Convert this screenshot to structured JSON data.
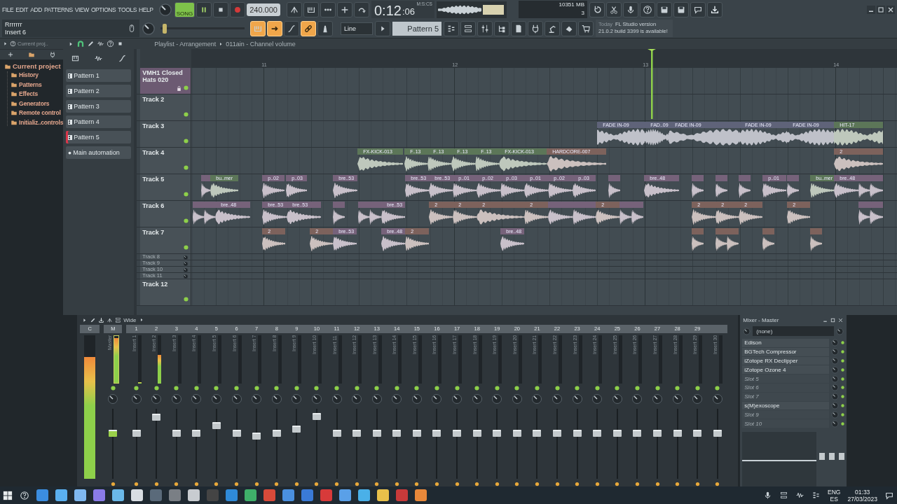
{
  "menu": [
    "FILE",
    "EDIT",
    "ADD",
    "PATTERNS",
    "VIEW",
    "OPTIONS",
    "TOOLS",
    "HELP"
  ],
  "hint": {
    "title": "Rrrrrrr",
    "subtitle": "Insert 6"
  },
  "transport": {
    "mode_label": "SONG",
    "song_mode": true,
    "tempo": "240.000"
  },
  "pitch": {
    "level": 0.03
  },
  "time": {
    "value": "0:12",
    "sub": ":06",
    "unit": "M:S:CS"
  },
  "monitor": {
    "polyphony": "10",
    "memory": "351 MB",
    "voices": "3"
  },
  "toggles": [
    {
      "on": true
    },
    {
      "on": true
    },
    {
      "on": false
    },
    {
      "on": true
    },
    {
      "on": false
    }
  ],
  "snap": "Line",
  "pattern": "Pattern 5",
  "news": {
    "date": "Today",
    "title": "FL Studio version",
    "body": "21.0.2 build 3399 is available!"
  },
  "browser": {
    "search": "Current proj..",
    "tree": [
      {
        "label": "Current project",
        "children": [
          {
            "label": "History"
          },
          {
            "label": "Patterns"
          },
          {
            "label": "Effects"
          },
          {
            "label": "Generators"
          },
          {
            "label": "Remote control"
          },
          {
            "label": "Initializ..controls"
          }
        ]
      }
    ]
  },
  "playlist": {
    "title": "Playlist - Arrangement",
    "path": "011ain - Channel volume",
    "patterns": [
      {
        "label": "Pattern 1",
        "kind": "pattern",
        "selected": false
      },
      {
        "label": "Pattern 2",
        "kind": "pattern",
        "selected": false
      },
      {
        "label": "Pattern 3",
        "kind": "pattern",
        "selected": false
      },
      {
        "label": "Pattern 4",
        "kind": "pattern",
        "selected": false
      },
      {
        "label": "Pattern 5",
        "kind": "pattern",
        "selected": true
      },
      {
        "label": "Main automation",
        "kind": "automation",
        "selected": false
      }
    ],
    "ruler": [
      "11",
      "12",
      "13",
      "14"
    ]
  },
  "tracks": [
    {
      "name": "VMH1 Closed Hats 020",
      "kind": "full",
      "color": "#6c5a72"
    },
    {
      "name": "Track 2",
      "kind": "full"
    },
    {
      "name": "Track 3",
      "kind": "full",
      "clips": [
        {
          "label": "FADE IN-09",
          "color": "#5f6379"
        },
        {
          "label": "FAD..09",
          "color": "#5f6379"
        },
        {
          "label": "FADE IN-09",
          "color": "#5f6379"
        },
        {
          "label": "FADE IN-09",
          "color": "#5f6379"
        },
        {
          "label": "FADE IN-09",
          "color": "#5f6379"
        },
        {
          "label": "HIT-17",
          "color": "#5c7658"
        }
      ]
    },
    {
      "name": "Track 4",
      "kind": "full",
      "clips": [
        {
          "label": "FX-KICK-013",
          "color": "#5c7658"
        },
        {
          "label": "F..13",
          "color": "#5c7658"
        },
        {
          "label": "F..13",
          "color": "#5c7658"
        },
        {
          "label": "F..13",
          "color": "#5c7658"
        },
        {
          "label": "F..13",
          "color": "#5c7658"
        },
        {
          "label": "FX-KICK-013",
          "color": "#5c7658"
        },
        {
          "label": "HARDCORE-007",
          "color": "#7d625c"
        },
        {
          "label": "2",
          "color": "#7d625c"
        }
      ]
    },
    {
      "name": "Track 5",
      "kind": "full",
      "clips": [
        {
          "color": "#76627a"
        },
        {
          "label": "bu..mer",
          "color": "#5c7658"
        },
        {
          "label": "p..02",
          "color": "#76627a"
        },
        {
          "label": "p..03",
          "color": "#76627a"
        },
        {
          "label": "bre..53",
          "color": "#76627a"
        },
        {
          "label": "bre..53",
          "color": "#76627a"
        },
        {
          "label": "bre..53",
          "color": "#76627a"
        },
        {
          "label": "p..01",
          "color": "#76627a"
        },
        {
          "label": "p..02",
          "color": "#76627a"
        },
        {
          "label": "p..03",
          "color": "#76627a"
        },
        {
          "label": "p..01",
          "color": "#76627a"
        },
        {
          "label": "p..02",
          "color": "#76627a"
        },
        {
          "label": "p..03",
          "color": "#76627a"
        },
        {
          "color": "#76627a"
        },
        {
          "label": "bre..48",
          "color": "#76627a"
        },
        {
          "color": "#76627a"
        },
        {
          "color": "#76627a"
        },
        {
          "color": "#76627a"
        },
        {
          "label": "p..01",
          "color": "#76627a"
        },
        {
          "color": "#76627a"
        },
        {
          "label": "bu..mer",
          "color": "#5c7658"
        },
        {
          "label": "bre..48",
          "color": "#76627a"
        },
        {
          "color": "#76627a"
        },
        {
          "color": "#76627a"
        }
      ]
    },
    {
      "name": "Track 6",
      "kind": "full",
      "clips": [
        {
          "color": "#76627a"
        },
        {
          "color": "#76627a"
        },
        {
          "label": "bre..48",
          "color": "#76627a"
        },
        {
          "label": "bre..53",
          "color": "#76627a"
        },
        {
          "label": "bre..53",
          "color": "#76627a"
        },
        {
          "color": "#76627a"
        },
        {
          "color": "#76627a"
        },
        {
          "color": "#76627a"
        },
        {
          "label": "bre..53",
          "color": "#76627a"
        },
        {
          "label": "2",
          "color": "#7d625c"
        },
        {
          "label": "2",
          "color": "#7d625c"
        },
        {
          "label": "2",
          "color": "#7d625c"
        },
        {
          "label": "2",
          "color": "#7d625c"
        },
        {
          "color": "#76627a"
        },
        {
          "color": "#76627a"
        },
        {
          "label": "2",
          "color": "#7d625c"
        },
        {
          "color": "#76627a"
        },
        {
          "color": "#76627a"
        },
        {
          "label": "2",
          "color": "#7d625c"
        },
        {
          "label": "2",
          "color": "#7d625c"
        },
        {
          "label": "2",
          "color": "#7d625c"
        },
        {
          "label": "2",
          "color": "#7d625c"
        },
        {
          "color": "#76627a"
        },
        {
          "color": "#76627a"
        }
      ]
    },
    {
      "name": "Track 7",
      "kind": "full",
      "clips": [
        {
          "label": "2",
          "color": "#7d625c"
        },
        {
          "label": "2",
          "color": "#7d625c"
        },
        {
          "label": "bre..53",
          "color": "#76627a"
        },
        {
          "label": "bre..48",
          "color": "#76627a"
        },
        {
          "label": "2",
          "color": "#7d625c"
        },
        {
          "label": "bre..48",
          "color": "#76627a"
        },
        {
          "color": "#7d625c"
        },
        {
          "color": "#7d625c"
        },
        {
          "color": "#7d625c"
        },
        {
          "color": "#7d625c"
        },
        {
          "color": "#7d625c"
        }
      ]
    },
    {
      "name": "Track 8",
      "kind": "collapsed"
    },
    {
      "name": "Track 9",
      "kind": "collapsed"
    },
    {
      "name": "Track 10",
      "kind": "collapsed"
    },
    {
      "name": "Track 11",
      "kind": "collapsed"
    },
    {
      "name": "Track 12",
      "kind": "full"
    }
  ],
  "mixer": {
    "view": "Wide",
    "strips": [
      {
        "number": "C",
        "kind": "current",
        "meter": {
          "level": 0.85
        }
      },
      {
        "number": "M",
        "label": "Master",
        "kind": "master",
        "meter": {
          "level": 0.95
        },
        "fader": {
          "level": 0.67
        }
      },
      {
        "number": "1",
        "label": "Insert 1",
        "kind": "insert",
        "meter": {
          "level": 0.03
        },
        "fader": {
          "level": 0.67
        }
      },
      {
        "number": "2",
        "label": "Insert 2",
        "kind": "insert",
        "meter": {
          "level": 0.6
        },
        "fader": {
          "level": 0.92
        }
      },
      {
        "number": "3",
        "label": "Insert 3",
        "kind": "insert",
        "fader": {
          "level": 0.67
        }
      },
      {
        "number": "4",
        "label": "Insert 4",
        "kind": "insert",
        "fader": {
          "level": 0.67
        }
      },
      {
        "number": "5",
        "label": "Insert 5",
        "kind": "insert",
        "fader": {
          "level": 0.79
        }
      },
      {
        "number": "6",
        "label": "Insert 6",
        "kind": "insert",
        "fader": {
          "level": 0.67
        }
      },
      {
        "number": "7",
        "label": "Insert 7",
        "kind": "insert",
        "fader": {
          "level": 0.62
        }
      },
      {
        "number": "8",
        "label": "Insert 8",
        "kind": "insert",
        "fader": {
          "level": 0.67
        }
      },
      {
        "number": "9",
        "label": "Insert 9",
        "kind": "insert",
        "fader": {
          "level": 0.73
        }
      },
      {
        "number": "10",
        "label": "Insert 10",
        "kind": "insert",
        "fader": {
          "level": 0.93
        }
      },
      {
        "number": "11",
        "label": "Insert 11",
        "kind": "insert",
        "fader": {
          "level": 0.67
        }
      },
      {
        "number": "12",
        "label": "Insert 12",
        "kind": "insert",
        "fader": {
          "level": 0.67
        }
      },
      {
        "number": "13",
        "label": "Insert 13",
        "kind": "insert",
        "fader": {
          "level": 0.67
        }
      },
      {
        "number": "14",
        "label": "Insert 14",
        "kind": "insert",
        "fader": {
          "level": 0.67
        }
      },
      {
        "number": "15",
        "label": "Insert 15",
        "kind": "insert",
        "fader": {
          "level": 0.67
        }
      },
      {
        "number": "16",
        "label": "Insert 16",
        "kind": "insert",
        "fader": {
          "level": 0.67
        }
      },
      {
        "number": "17",
        "label": "Insert 17",
        "kind": "insert",
        "fader": {
          "level": 0.67
        }
      },
      {
        "number": "18",
        "label": "Insert 18",
        "kind": "insert",
        "fader": {
          "level": 0.67
        }
      },
      {
        "number": "19",
        "label": "Insert 19",
        "kind": "insert",
        "fader": {
          "level": 0.67
        }
      },
      {
        "number": "20",
        "label": "Insert 20",
        "kind": "insert",
        "fader": {
          "level": 0.67
        }
      },
      {
        "number": "21",
        "label": "Insert 21",
        "kind": "insert",
        "fader": {
          "level": 0.67
        }
      },
      {
        "number": "22",
        "label": "Insert 22",
        "kind": "insert",
        "fader": {
          "level": 0.67
        }
      },
      {
        "number": "23",
        "label": "Insert 23",
        "kind": "insert",
        "fader": {
          "level": 0.67
        }
      },
      {
        "number": "24",
        "label": "Insert 24",
        "kind": "insert",
        "fader": {
          "level": 0.67
        }
      },
      {
        "number": "25",
        "label": "Insert 25",
        "kind": "insert",
        "fader": {
          "level": 0.67
        }
      },
      {
        "number": "26",
        "label": "Insert 26",
        "kind": "insert",
        "fader": {
          "level": 0.67
        }
      },
      {
        "number": "27",
        "label": "Insert 27",
        "kind": "insert",
        "fader": {
          "level": 0.67
        }
      },
      {
        "number": "28",
        "label": "Insert 28",
        "kind": "insert",
        "fader": {
          "level": 0.67
        }
      },
      {
        "number": "29",
        "label": "Insert 29",
        "kind": "insert",
        "fader": {
          "level": 0.67
        }
      },
      {
        "label": "Insert 30",
        "kind": "insert",
        "fader": {
          "level": 0.67
        }
      }
    ]
  },
  "master_panel": {
    "title": "Mixer - Master",
    "input": "(none)",
    "slots": [
      {
        "name": "Edison",
        "filled": true
      },
      {
        "name": "BGTech Compressor",
        "filled": true
      },
      {
        "name": "iZotope RX Declipper",
        "filled": true
      },
      {
        "name": "iZotope Ozone 4",
        "filled": true
      },
      {
        "name": "Slot 5",
        "filled": false
      },
      {
        "name": "Slot 6",
        "filled": false
      },
      {
        "name": "Slot 7",
        "filled": false
      },
      {
        "name": "s(M)exoscope",
        "filled": true
      },
      {
        "name": "Slot 9",
        "filled": false
      },
      {
        "name": "Slot 10",
        "filled": false
      }
    ]
  },
  "taskbar": {
    "language": "ENG",
    "layout": "ES",
    "time": "01:33",
    "date": "27/03/2023"
  }
}
